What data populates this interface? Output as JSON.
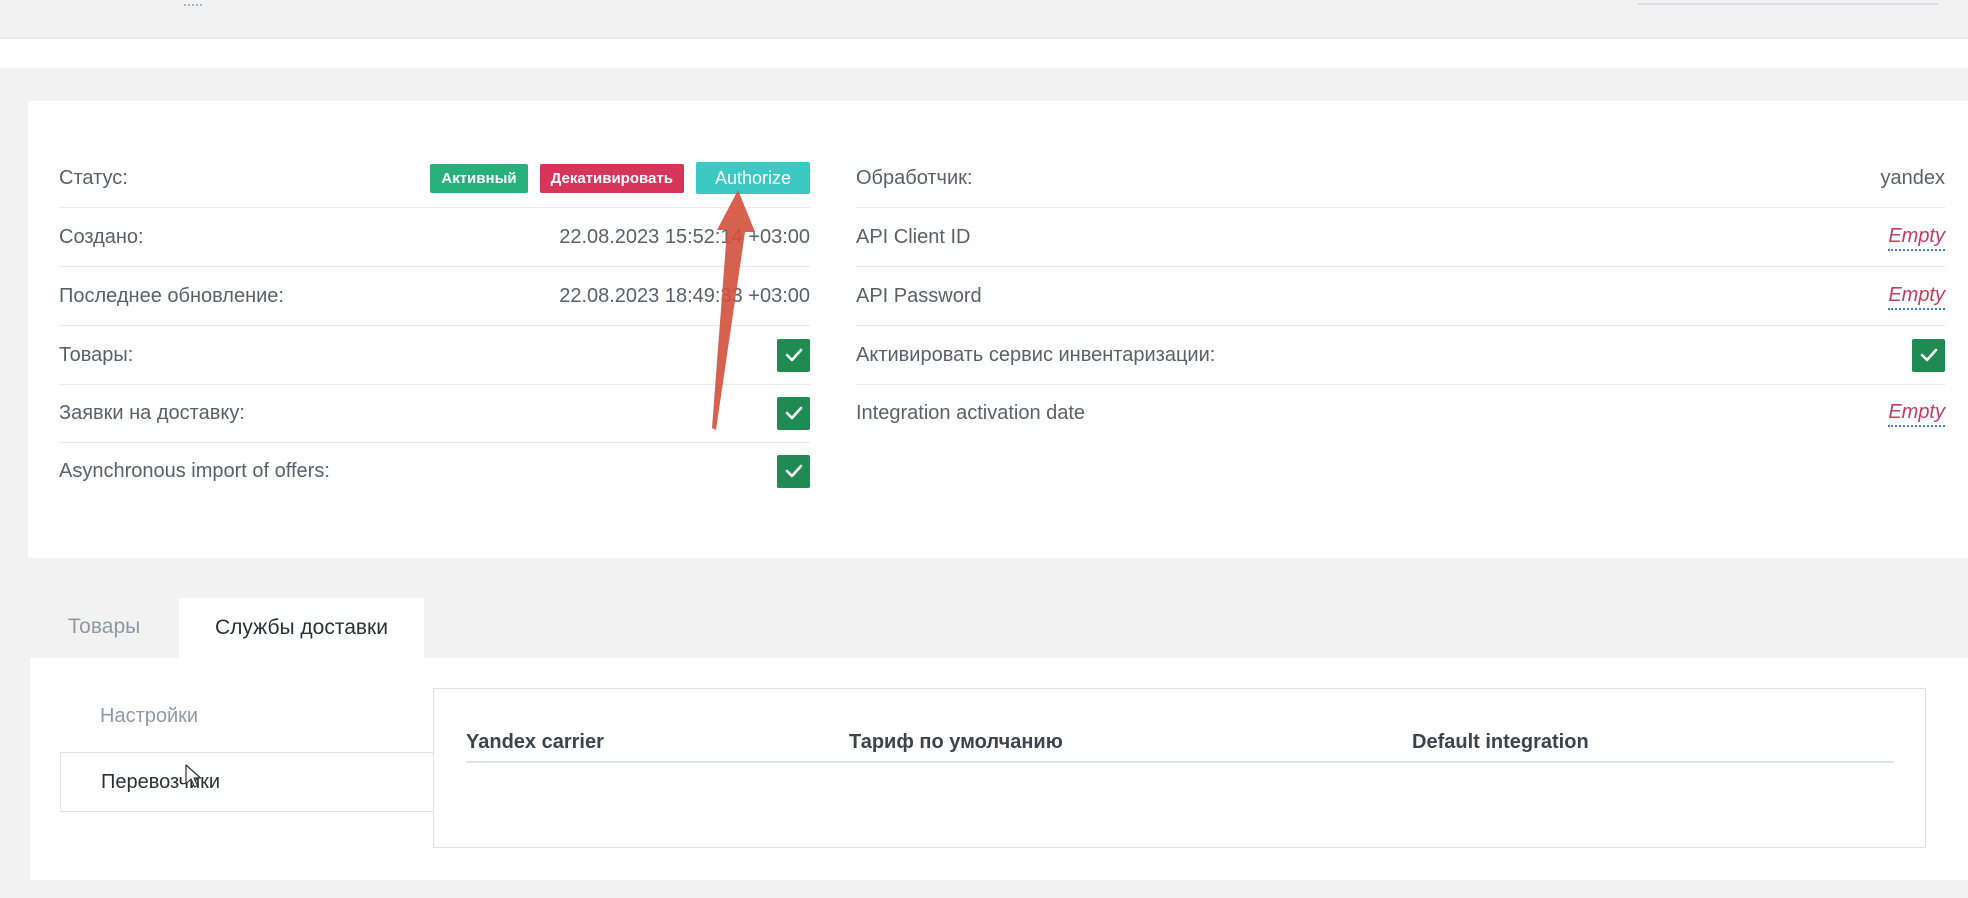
{
  "info": {
    "left_rows": [
      {
        "label": "Статус:"
      },
      {
        "label": "Создано:",
        "value": "22.08.2023 15:52:14 +03:00"
      },
      {
        "label": "Последнее обновление:",
        "value": "22.08.2023 18:49:33 +03:00"
      },
      {
        "label": "Товары:",
        "checked": true
      },
      {
        "label": "Заявки на доставку:",
        "checked": true
      },
      {
        "label": "Asynchronous import of offers:",
        "checked": true
      }
    ],
    "status_badge": "Активный",
    "deactivate_label": "Декативировать",
    "authorize_label": "Authorize",
    "right_rows": [
      {
        "label": "Обработчик:",
        "value": "yandex"
      },
      {
        "label": "API Client ID",
        "value": "Empty"
      },
      {
        "label": "API Password",
        "value": "Empty"
      },
      {
        "label": "Активировать сервис инвентаризации:",
        "checked": true
      },
      {
        "label": "Integration activation date",
        "value": "Empty"
      }
    ]
  },
  "tabs": [
    {
      "label": "Товары",
      "active": false
    },
    {
      "label": "Службы доставки",
      "active": true
    }
  ],
  "side_menu": [
    {
      "label": "Настройки",
      "active": false
    },
    {
      "label": "Перевозчики",
      "active": true
    }
  ],
  "table": {
    "columns": [
      "Yandex carrier",
      "Тариф по умолчанию",
      "Default integration"
    ]
  },
  "colors": {
    "active_badge": "#27b07a",
    "deactivate_badge": "#d7365a",
    "authorize_button": "#3cc9c3",
    "checkbox": "#1f8a52",
    "empty_text": "#c23d5c",
    "annotation_arrow": "#d2503c"
  },
  "icons": {
    "checkbox": "check-icon",
    "annotation": "annotation-arrow-icon",
    "cursor": "mouse-cursor-icon"
  }
}
